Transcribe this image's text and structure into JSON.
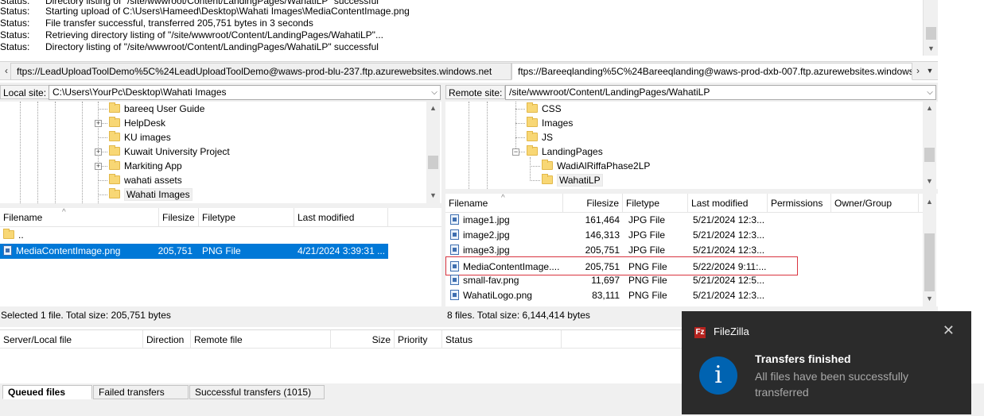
{
  "message_log": {
    "lines": [
      {
        "label": "Status:",
        "text": "Directory listing of \"/site/wwwroot/Content/LandingPages/WahatiLP\" successful"
      },
      {
        "label": "Status:",
        "text": "Starting upload of C:\\Users\\Hameed\\Desktop\\Wahati Images\\MediaContentImage.png"
      },
      {
        "label": "Status:",
        "text": "File transfer successful, transferred 205,751 bytes in 3 seconds"
      },
      {
        "label": "Status:",
        "text": "Retrieving directory listing of \"/site/wwwroot/Content/LandingPages/WahatiLP\"..."
      },
      {
        "label": "Status:",
        "text": "Directory listing of \"/site/wwwroot/Content/LandingPages/WahatiLP\" successful"
      }
    ]
  },
  "tabs": [
    {
      "label": "ftps://LeadUploadToolDemo%5C%24LeadUploadToolDemo@waws-prod-blu-237.ftp.azurewebsites.windows.net"
    },
    {
      "label": "ftps://Bareeqlanding%5C%24Bareeqlanding@waws-prod-dxb-007.ftp.azurewebsites.windows."
    }
  ],
  "local": {
    "site_label": "Local site:",
    "site_path": "C:\\Users\\YourPc\\Desktop\\Wahati Images",
    "tree": [
      {
        "label": "bareeq User Guide",
        "expandable": false
      },
      {
        "label": "HelpDesk",
        "expandable": true
      },
      {
        "label": "KU images",
        "expandable": false
      },
      {
        "label": "Kuwait University Project",
        "expandable": true
      },
      {
        "label": "Markiting App",
        "expandable": true
      },
      {
        "label": "wahati assets",
        "expandable": false
      },
      {
        "label": "Wahati Images",
        "expandable": false
      }
    ],
    "columns": [
      "Filename",
      "Filesize",
      "Filetype",
      "Last modified"
    ],
    "files": [
      {
        "name": "..",
        "size": "",
        "type": "",
        "modified": "",
        "folder": true
      },
      {
        "name": "MediaContentImage.png",
        "size": "205,751",
        "type": "PNG File",
        "modified": "4/21/2024 3:39:31 ...",
        "folder": false
      }
    ],
    "status": "Selected 1 file. Total size: 205,751 bytes"
  },
  "remote": {
    "site_label": "Remote site:",
    "site_path": "/site/wwwroot/Content/LandingPages/WahatiLP",
    "tree": [
      {
        "label": "CSS"
      },
      {
        "label": "Images"
      },
      {
        "label": "JS"
      },
      {
        "label": "LandingPages"
      },
      {
        "label": "WadiAlRiffaPhase2LP"
      },
      {
        "label": "WahatiLP"
      }
    ],
    "columns": [
      "Filename",
      "Filesize",
      "Filetype",
      "Last modified",
      "Permissions",
      "Owner/Group"
    ],
    "files": [
      {
        "name": "image1.jpg",
        "size": "161,464",
        "type": "JPG File",
        "modified": "5/21/2024 12:3..."
      },
      {
        "name": "image2.jpg",
        "size": "146,313",
        "type": "JPG File",
        "modified": "5/21/2024 12:3..."
      },
      {
        "name": "image3.jpg",
        "size": "205,751",
        "type": "JPG File",
        "modified": "5/21/2024 12:3..."
      },
      {
        "name": "MediaContentImage....",
        "size": "205,751",
        "type": "PNG File",
        "modified": "5/22/2024 9:11:..."
      },
      {
        "name": "small-fav.png",
        "size": "11,697",
        "type": "PNG File",
        "modified": "5/21/2024 12:5..."
      },
      {
        "name": "WahatiLogo.png",
        "size": "83,111",
        "type": "PNG File",
        "modified": "5/21/2024 12:3..."
      }
    ],
    "status": "8 files. Total size: 6,144,414 bytes"
  },
  "queue": {
    "columns": [
      "Server/Local file",
      "Direction",
      "Remote file",
      "Size",
      "Priority",
      "Status"
    ],
    "tabs": [
      "Queued files",
      "Failed transfers",
      "Successful transfers (1015)"
    ]
  },
  "toast": {
    "app_name": "FileZilla",
    "app_icon_glyph": "Fz",
    "title": "Transfers finished",
    "message": "All files have been successfully transferred",
    "info_glyph": "i",
    "close_glyph": "✕"
  },
  "colors": {
    "selection": "#0078d7",
    "highlight_border": "#d9343f",
    "toast_bg": "#2b2b2b",
    "info_blue": "#0063b1"
  }
}
